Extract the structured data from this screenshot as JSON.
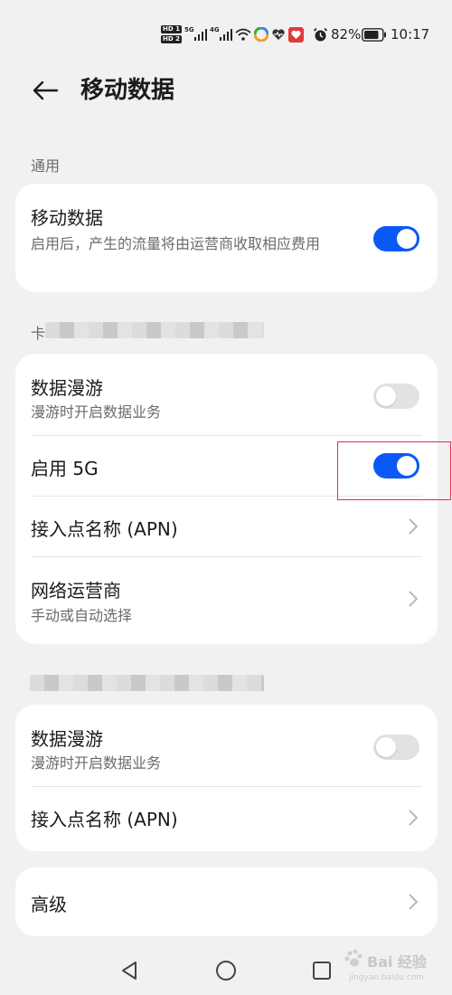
{
  "status_bar": {
    "hd1": "HD 1",
    "hd2": "HD 2",
    "sig1": "5G",
    "sig2": "4G",
    "battery": "82%",
    "time": "10:17"
  },
  "header": {
    "title": "移动数据"
  },
  "general": {
    "label": "通用",
    "mobile_data": {
      "title": "移动数据",
      "subtitle": "启用后，产生的流量将由运营商收取相应费用",
      "enabled": true
    }
  },
  "sim1": {
    "label": "卡",
    "data_roaming": {
      "title": "数据漫游",
      "subtitle": "漫游时开启数据业务",
      "enabled": false
    },
    "enable_5g": {
      "title": "启用 5G",
      "enabled": true
    },
    "apn": {
      "title": "接入点名称 (APN)"
    },
    "operator": {
      "title": "网络运营商",
      "subtitle": "手动或自动选择"
    }
  },
  "sim2": {
    "data_roaming": {
      "title": "数据漫游",
      "subtitle": "漫游时开启数据业务",
      "enabled": false
    },
    "apn": {
      "title": "接入点名称 (APN)"
    }
  },
  "advanced": {
    "title": "高级"
  },
  "watermark": {
    "text": "Bai 经验",
    "sub": "jingyan.baidu.com"
  },
  "colors": {
    "accent": "#0a59f7",
    "highlight": "#e0303a",
    "background": "#f1f1f3"
  }
}
